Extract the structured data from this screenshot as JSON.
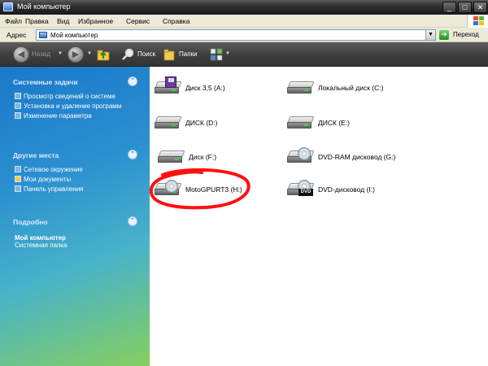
{
  "window": {
    "title": "Мой компьютер"
  },
  "menu": {
    "items": [
      "Файл",
      "Правка",
      "Вид",
      "Избранное",
      "Сервис",
      "Справка"
    ]
  },
  "address": {
    "label": "Адрес",
    "value": "Мой компьютер",
    "go_label": "Переход"
  },
  "toolbar": {
    "back_label": "Назад",
    "search_label": "Поиск",
    "folders_label": "Папки"
  },
  "sidebar": {
    "system_tasks": {
      "title": "Системные задачи",
      "items": [
        "Просмотр сведений о системе",
        "Установка и удаление программ",
        "Изменение параметра"
      ]
    },
    "other_places": {
      "title": "Другие места",
      "items": [
        "Сетевое окружение",
        "Мои документы",
        "Панель управления"
      ]
    },
    "details": {
      "title": "Подробно",
      "name": "Мой компьютер",
      "desc": "Системная папка"
    }
  },
  "drives": [
    {
      "label": "Диск 3,5 (A:)",
      "kind": "floppy"
    },
    {
      "label": "Локальный диск (C:)",
      "kind": "hdd"
    },
    {
      "label": "ДИСК (D:)",
      "kind": "hdd"
    },
    {
      "label": "ДИСК (E:)",
      "kind": "hdd"
    },
    {
      "label": "Диск (F:)",
      "kind": "hdd"
    },
    {
      "label": "DVD-RAM дисковод (G:)",
      "kind": "cd"
    },
    {
      "label": "MotoGPURT3 (H:)",
      "kind": "cd-hdd",
      "highlighted": true
    },
    {
      "label": "DVD-дисковод (I:)",
      "kind": "dvd"
    }
  ],
  "dvd_badge": "DVD",
  "colors": {
    "sidebar_top": "#1c78c8",
    "sidebar_bottom": "#86cf5f",
    "highlight_circle": "#ff1010",
    "title_bar": "#2c2c2c"
  }
}
